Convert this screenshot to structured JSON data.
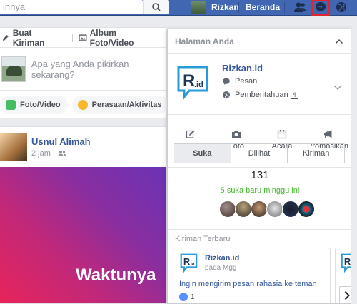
{
  "topbar": {
    "search_text": "innya",
    "profile_name": "Rizkan",
    "home_label": "Beranda"
  },
  "composer": {
    "tab_post": "Buat Kiriman",
    "tab_album": "Album Foto/Video",
    "placeholder": "Apa yang Anda pikirkan sekarang?",
    "action_photo": "Foto/Video",
    "action_feeling": "Perasaan/Aktivitas"
  },
  "post": {
    "author": "Usnul Alimah",
    "time": "2 jam ·",
    "caption": "Waktunya"
  },
  "panel": {
    "title": "Halaman Anda",
    "page_name": "Rizkan.id",
    "messages_label": "Pesan",
    "notifications_label": "Pemberitahuan",
    "notifications_count": "4",
    "actions": [
      "Terbitkan",
      "Foto",
      "Acara",
      "Promosikan"
    ],
    "tabs": [
      "Suka",
      "Dilihat",
      "Kiriman"
    ],
    "likes_count": "131",
    "likes_sub": "5 suka baru minggu ini",
    "recent_title": "Kiriman Terbaru",
    "card": {
      "name": "Rizkan.id",
      "time": "pada Mgg",
      "text": "Ingin mengirim pesan rahasia ke teman",
      "likes": "1"
    }
  },
  "colors": {
    "brand_blue": "#4267b2",
    "highlight_red": "#e0262c",
    "link_blue": "#365899",
    "green": "#42b72a"
  }
}
